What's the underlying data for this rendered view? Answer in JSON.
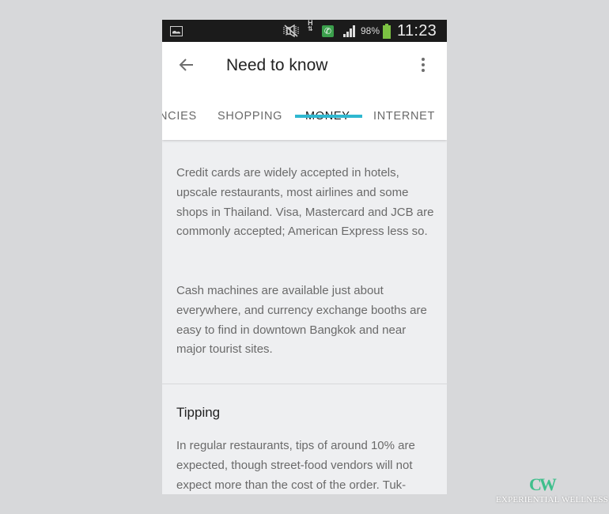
{
  "status_bar": {
    "icons": [
      "gallery-icon",
      "mute-icon",
      "hsdpa-icon",
      "call-icon",
      "signal-icon",
      "battery-icon"
    ],
    "network_type": "H",
    "battery_percent": "98%",
    "time": "11:23",
    "colors": {
      "background": "#1b1b1b",
      "call_badge": "#3b9f4c",
      "battery": "#7cc243"
    }
  },
  "app_bar": {
    "back_icon": "arrow-left-icon",
    "title": "Need to know",
    "more_icon": "more-vert-icon"
  },
  "tabs": [
    {
      "label": "NCIES",
      "active": false
    },
    {
      "label": "SHOPPING",
      "active": false
    },
    {
      "label": "MONEY",
      "active": true
    },
    {
      "label": "INTERNET",
      "active": false
    }
  ],
  "accent_color": "#2fb8d0",
  "content": {
    "paragraphs": [
      "Credit cards are widely accepted in hotels, upscale restaurants, most airlines and some shops in Thailand. Visa, Mastercard and JCB are commonly accepted; American Express less so.",
      "Cash machines are available just about everywhere, and currency exchange booths are easy to find in downtown Bangkok and near major tourist sites."
    ],
    "section": {
      "title": "Tipping",
      "text": "In regular restaurants, tips of around 10% are expected, though street-food vendors will not expect more than the cost of the order. Tuk-"
    }
  },
  "watermark": {
    "logo": "CW",
    "text": "EXPERIENTIAL WELLNESS"
  }
}
